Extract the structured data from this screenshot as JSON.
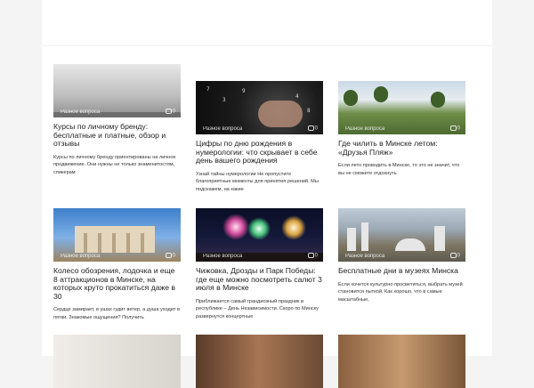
{
  "cards": [
    {
      "category": "Разное вопроса",
      "comments": "0",
      "title": "Курсы по личному бренду: бесплатные и платные, обзор и отзывы",
      "excerpt": "Курсы по личному бренду ориентированы на личное продвижение. Они нужны не только знаменитостям, спикерам"
    },
    {
      "category": "Разное вопроса",
      "comments": "0",
      "title": "Цифры по дню рождения в нумерологии: что скрывает в себе день вашего рождения",
      "excerpt": "Узнай тайны нумерологии Не пропустите благоприятные моменты для принятия решений. Мы подскажем, на какие"
    },
    {
      "category": "Разное вопроса",
      "comments": "0",
      "title": "Где чилить в Минске летом: «Друзья Пляж»",
      "excerpt": "Если лето проводить в Минске, то это не значит, что вы не сможете отдохнуть"
    },
    {
      "category": "Разное вопроса",
      "comments": "0",
      "title": "Колесо обозрения, лодочка и еще 8 аттракционов в Минске, на которых круто прокатиться даже в 30",
      "excerpt": "Сердце замирает, в ушах гудит ветер, а душа уходит в пятки. Знакомые ощущения? Получить"
    },
    {
      "category": "Разное вопроса",
      "comments": "0",
      "title": "Чижовка, Дрозды и Парк Победы: где еще можно посмотреть салют 3 июля в Минске",
      "excerpt": "Приближается самый грандиозный праздник в республике – День Независимости. Скоро по Минску развернутся концертные"
    },
    {
      "category": "Разное вопроса",
      "comments": "0",
      "title": "Бесплатные дни в музеях Минска",
      "excerpt": "Если хочется культурно просветиться, выбрать музей становится пыткой. Как хорошо, что в самые масштабные,"
    }
  ]
}
